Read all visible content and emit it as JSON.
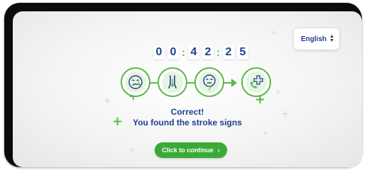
{
  "language": {
    "selected": "English"
  },
  "timer": {
    "d1": "0",
    "d2": "0",
    "d3": "4",
    "d4": "2",
    "d5": "2",
    "d6": "5",
    "separator": ":"
  },
  "steps": [
    {
      "icon": "face-drooping-icon"
    },
    {
      "icon": "arm-weakness-icon"
    },
    {
      "icon": "speech-difficulty-icon"
    },
    {
      "icon": "emergency-call-icon"
    }
  ],
  "message": {
    "title": "Correct!",
    "subtitle": "You found the stroke signs"
  },
  "button": {
    "label": "Click to continue",
    "arrow": "›"
  },
  "colors": {
    "brand_green": "#58b947",
    "button_green": "#3aaa35",
    "navy": "#1f3f8f",
    "frame": "#0b0b0b"
  }
}
